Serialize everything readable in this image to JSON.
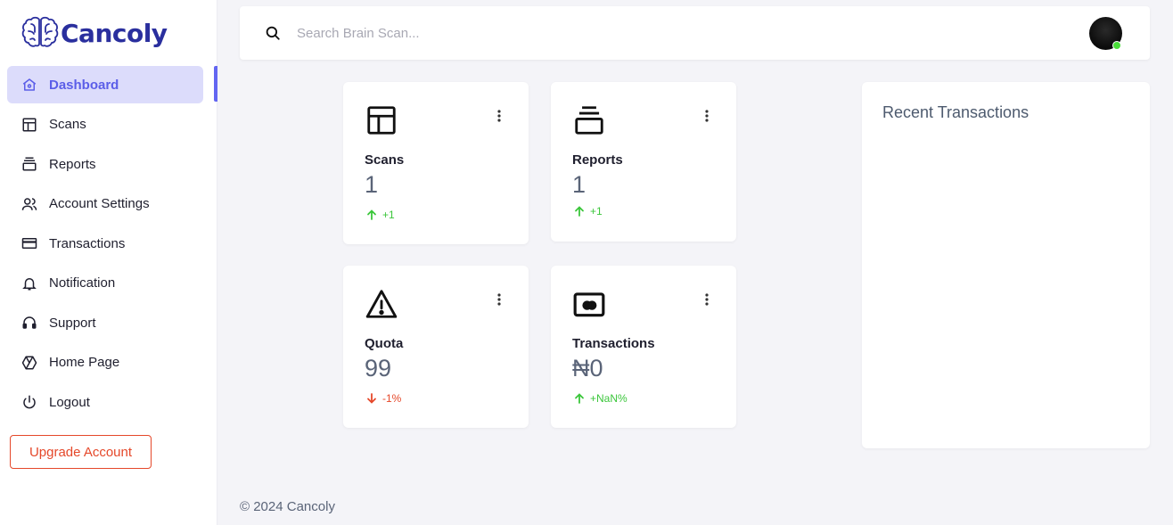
{
  "brand": {
    "name": "Cancoly",
    "color": "#2a2f9e"
  },
  "sidebar": {
    "items": [
      {
        "label": "Dashboard",
        "icon": "home-icon",
        "active": true
      },
      {
        "label": "Scans",
        "icon": "layout-icon"
      },
      {
        "label": "Reports",
        "icon": "stack-icon"
      },
      {
        "label": "Account Settings",
        "icon": "users-icon"
      },
      {
        "label": "Transactions",
        "icon": "credit-card-icon"
      },
      {
        "label": "Notification",
        "icon": "bell-icon"
      },
      {
        "label": "Support",
        "icon": "headset-icon"
      },
      {
        "label": "Home Page",
        "icon": "web-icon"
      },
      {
        "label": "Logout",
        "icon": "power-icon"
      }
    ],
    "upgrade_label": "Upgrade Account"
  },
  "search": {
    "placeholder": "Search Brain Scan..."
  },
  "cards": [
    {
      "label": "Scans",
      "value": "1",
      "delta": "+1",
      "trend": "up",
      "icon": "layout-icon"
    },
    {
      "label": "Reports",
      "value": "1",
      "delta": "+1",
      "trend": "up",
      "icon": "stack-icon"
    },
    {
      "label": "Quota",
      "value": "99",
      "delta": "-1%",
      "trend": "down",
      "icon": "warning-icon"
    },
    {
      "label": "Transactions",
      "value": "₦0",
      "delta": "+NaN%",
      "trend": "up",
      "icon": "cash-icon"
    }
  ],
  "recent": {
    "title": "Recent Transactions"
  },
  "footer": {
    "text": "© 2024 Cancoly"
  },
  "colors": {
    "accent": "#6366f1",
    "up": "#3bc63b",
    "down": "#e5482a",
    "upgrade": "#e5482a"
  }
}
